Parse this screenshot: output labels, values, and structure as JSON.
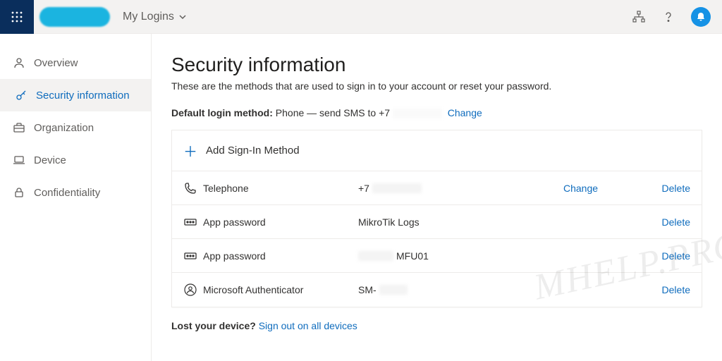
{
  "header": {
    "title": "My Logins"
  },
  "sidebar": {
    "items": [
      {
        "label": "Overview"
      },
      {
        "label": "Security information"
      },
      {
        "label": "Organization"
      },
      {
        "label": "Device"
      },
      {
        "label": "Confidentiality"
      }
    ]
  },
  "page": {
    "heading": "Security information",
    "subtitle": "These are the methods that are used to sign in to your account or reset your password.",
    "default_label": "Default login method:",
    "default_value_prefix": "Phone — send SMS to +7",
    "change": "Change",
    "add_method": "Add Sign-In Method",
    "lost_prompt": "Lost your device?",
    "lost_link": "Sign out on all devices"
  },
  "methods": [
    {
      "name": "Telephone",
      "value_prefix": "+7",
      "redact_w": 70,
      "change": "Change",
      "delete": "Delete"
    },
    {
      "name": "App password",
      "value_prefix": "MikroTik Logs",
      "redact_w": 0,
      "change": "",
      "delete": "Delete"
    },
    {
      "name": "App password",
      "value_prefix": "",
      "redact_w": 50,
      "value_suffix": "MFU01",
      "change": "",
      "delete": "Delete"
    },
    {
      "name": "Microsoft Authenticator",
      "value_prefix": "SM-",
      "redact_w": 40,
      "change": "",
      "delete": "Delete"
    }
  ],
  "watermark": "MHELP.PRO"
}
